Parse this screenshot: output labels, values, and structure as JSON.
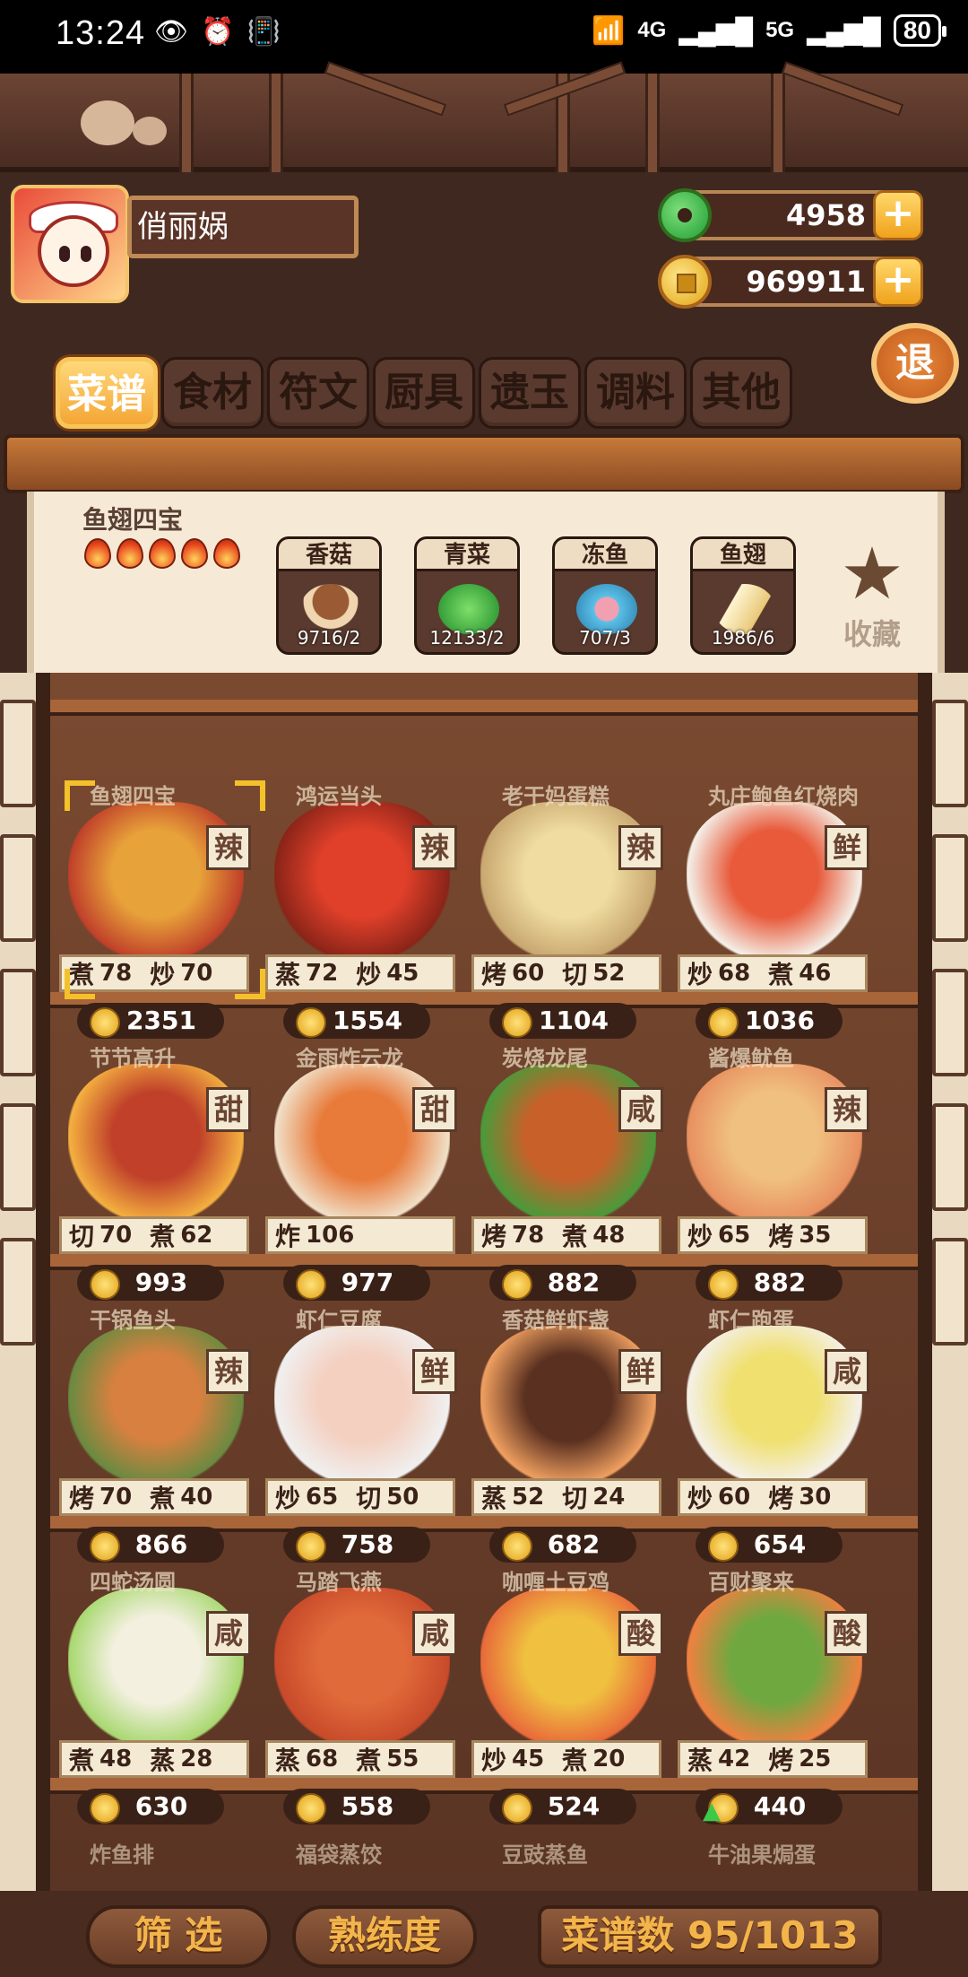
{
  "status_bar": {
    "time": "13:24",
    "battery": "80",
    "net1": "4G",
    "net2": "5G"
  },
  "player": {
    "name": "俏丽娲"
  },
  "currency": {
    "jade": "4958",
    "coins": "969911"
  },
  "exit_label": "退",
  "tabs": [
    {
      "label": "菜谱",
      "active": true
    },
    {
      "label": "食材"
    },
    {
      "label": "符文"
    },
    {
      "label": "厨具"
    },
    {
      "label": "遗玉"
    },
    {
      "label": "调料"
    },
    {
      "label": "其他"
    }
  ],
  "selected_recipe": {
    "name": "鱼翅四宝",
    "flames": 5,
    "ingredients": [
      {
        "name": "香菇",
        "count": "9716/2"
      },
      {
        "name": "青菜",
        "count": "12133/2"
      },
      {
        "name": "冻鱼",
        "count": "707/3"
      },
      {
        "name": "鱼翅",
        "count": "1986/6"
      }
    ],
    "favorite_label": "收藏"
  },
  "recipes": [
    {
      "name": "鱼翅四宝",
      "flavor": "辣",
      "s1": "煮",
      "v1": "78",
      "s2": "炒",
      "v2": "70",
      "price": "2351",
      "selected": true
    },
    {
      "name": "鸿运当头",
      "flavor": "辣",
      "s1": "蒸",
      "v1": "72",
      "s2": "炒",
      "v2": "45",
      "price": "1554"
    },
    {
      "name": "老干妈蛋糕",
      "flavor": "辣",
      "s1": "烤",
      "v1": "60",
      "s2": "切",
      "v2": "52",
      "price": "1104"
    },
    {
      "name": "丸庄鲍鱼红烧肉",
      "flavor": "鲜",
      "s1": "炒",
      "v1": "68",
      "s2": "煮",
      "v2": "46",
      "price": "1036"
    },
    {
      "name": "节节高升",
      "flavor": "甜",
      "s1": "切",
      "v1": "70",
      "s2": "煮",
      "v2": "62",
      "price": "993"
    },
    {
      "name": "金雨炸云龙",
      "flavor": "甜",
      "s1": "炸",
      "v1": "106",
      "s2": "",
      "v2": "",
      "price": "977"
    },
    {
      "name": "炭烧龙尾",
      "flavor": "咸",
      "s1": "烤",
      "v1": "78",
      "s2": "煮",
      "v2": "48",
      "price": "882"
    },
    {
      "name": "酱爆鱿鱼",
      "flavor": "辣",
      "s1": "炒",
      "v1": "65",
      "s2": "烤",
      "v2": "35",
      "price": "882"
    },
    {
      "name": "干锅鱼头",
      "flavor": "辣",
      "s1": "烤",
      "v1": "70",
      "s2": "煮",
      "v2": "40",
      "price": "866"
    },
    {
      "name": "虾仁豆腐",
      "flavor": "鲜",
      "s1": "炒",
      "v1": "65",
      "s2": "切",
      "v2": "50",
      "price": "758"
    },
    {
      "name": "香菇鲜虾盏",
      "flavor": "鲜",
      "s1": "蒸",
      "v1": "52",
      "s2": "切",
      "v2": "24",
      "price": "682"
    },
    {
      "name": "虾仁跑蛋",
      "flavor": "咸",
      "s1": "炒",
      "v1": "60",
      "s2": "烤",
      "v2": "30",
      "price": "654"
    },
    {
      "name": "四蛇汤圆",
      "flavor": "咸",
      "s1": "煮",
      "v1": "48",
      "s2": "蒸",
      "v2": "28",
      "price": "630"
    },
    {
      "name": "马踏飞燕",
      "flavor": "咸",
      "s1": "蒸",
      "v1": "68",
      "s2": "煮",
      "v2": "55",
      "price": "558"
    },
    {
      "name": "咖喱土豆鸡",
      "flavor": "酸",
      "s1": "炒",
      "v1": "45",
      "s2": "煮",
      "v2": "20",
      "price": "524"
    },
    {
      "name": "百财聚来",
      "flavor": "酸",
      "s1": "蒸",
      "v1": "42",
      "s2": "烤",
      "v2": "25",
      "price": "440",
      "up": true
    }
  ],
  "next_row": [
    "炸鱼排",
    "福袋蒸饺",
    "豆豉蒸鱼",
    "牛油果焗蛋"
  ],
  "buttons": {
    "filter": "筛  选",
    "mastery": "熟练度",
    "count": "菜谱数 95/1013"
  },
  "colors": {
    "accent": "#f4a635",
    "panel": "#f6ead6",
    "board": "#6a3e28"
  }
}
